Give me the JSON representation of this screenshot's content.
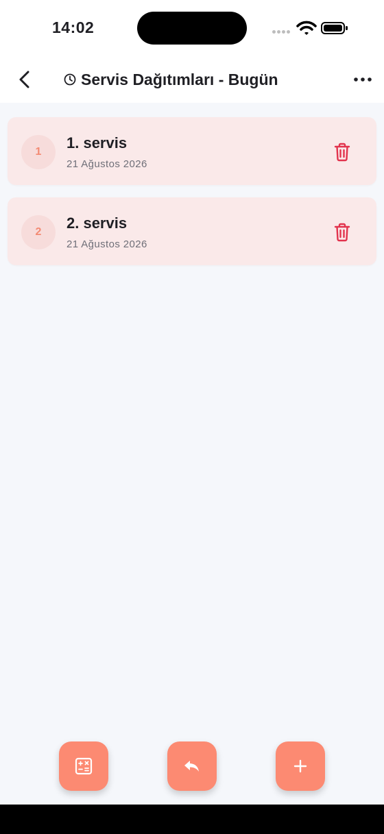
{
  "status_bar": {
    "time": "14:02"
  },
  "nav": {
    "title": "Servis Dağıtımları - Bugün",
    "back_icon": "chevron-left-icon",
    "title_icon": "clock-icon",
    "more_icon": "more-horizontal-icon"
  },
  "items": [
    {
      "index": "1",
      "title": "1. servis",
      "date": "21 Ağustos 2026"
    },
    {
      "index": "2",
      "title": "2. servis",
      "date": "21 Ağustos 2026"
    }
  ],
  "actions": [
    {
      "name": "calculator",
      "icon": "calculator-icon"
    },
    {
      "name": "undo",
      "icon": "undo-icon"
    },
    {
      "name": "add",
      "icon": "plus-icon"
    }
  ],
  "colors": {
    "accent": "#fc8a72",
    "card_background": "#fae9e9",
    "badge_background": "#f7dcdb",
    "badge_text": "#f38a73",
    "delete": "#e2334d",
    "page_background": "#f5f7fb"
  }
}
